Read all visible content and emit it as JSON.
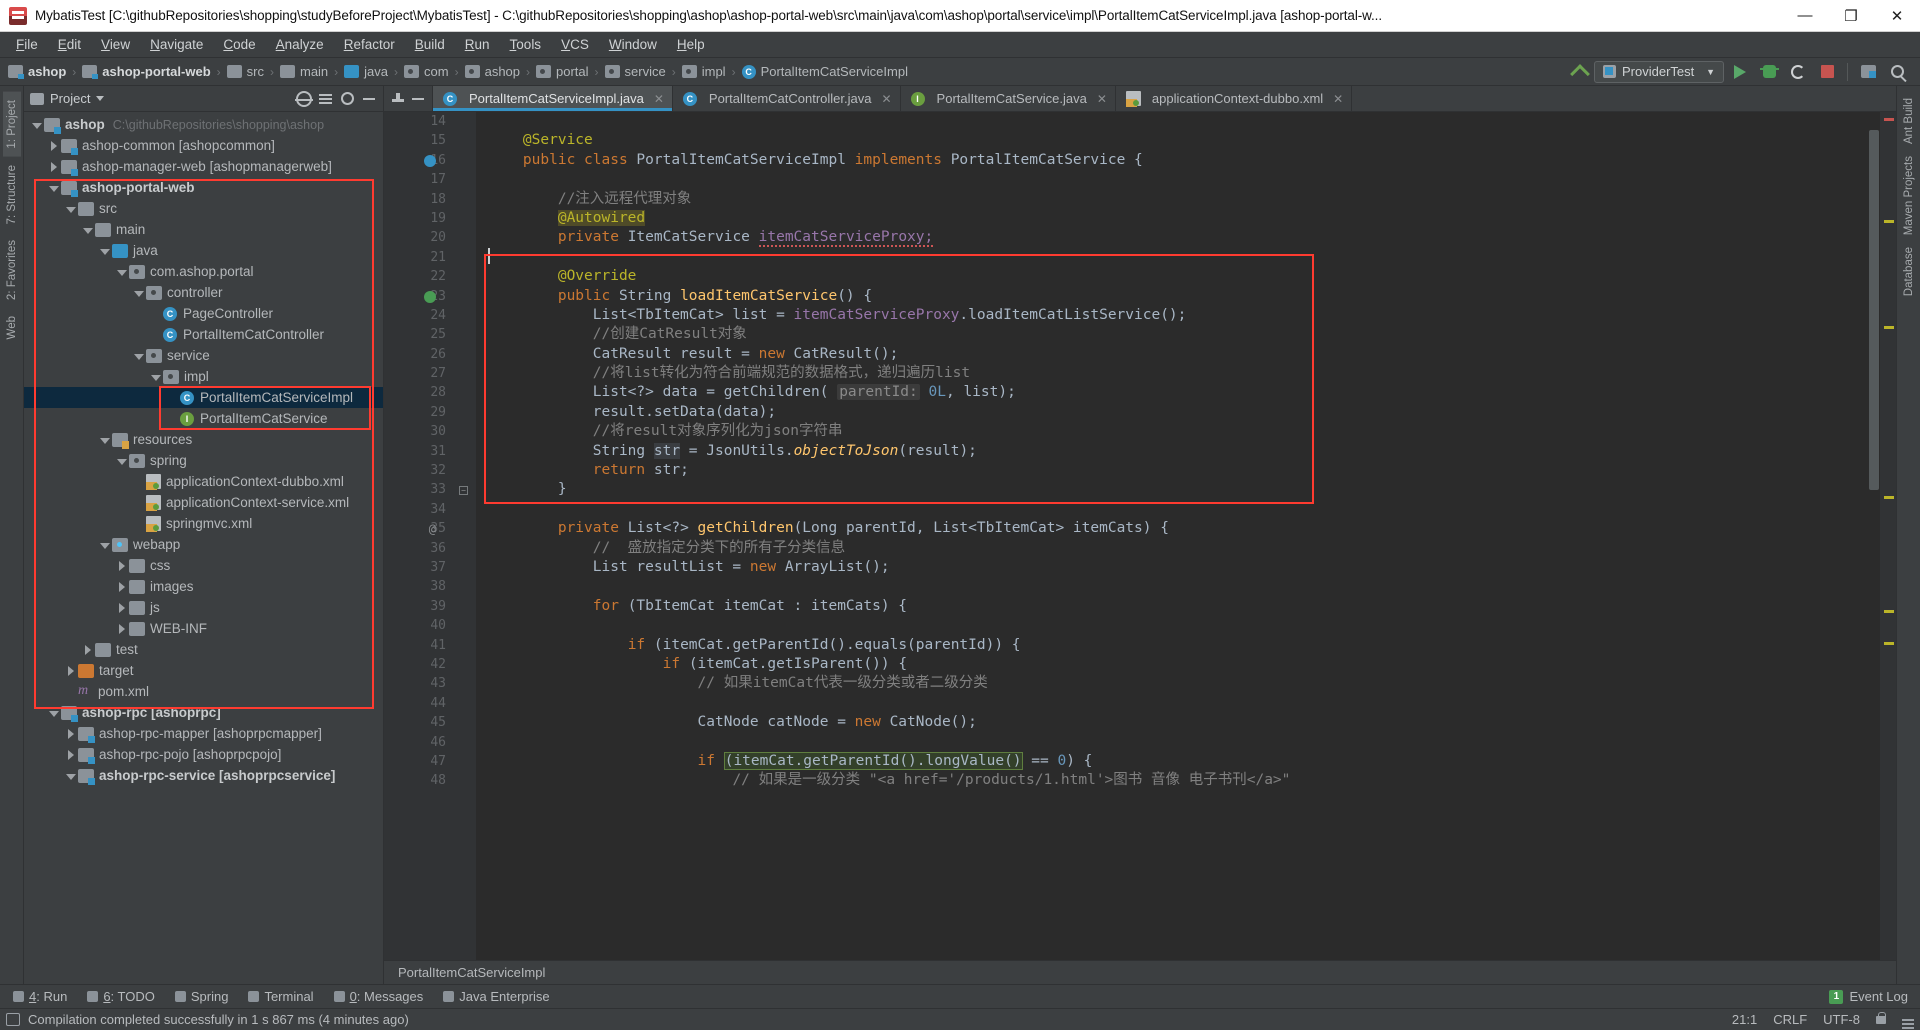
{
  "window": {
    "title": "MybatisTest [C:\\githubRepositories\\shopping\\studyBeforeProject\\MybatisTest] - C:\\githubRepositories\\shopping\\ashop\\ashop-portal-web\\src\\main\\java\\com\\ashop\\portal\\service\\impl\\PortalItemCatServiceImpl.java [ashop-portal-w...",
    "minimize": "—",
    "maximize": "❐",
    "close": "✕"
  },
  "menu": [
    {
      "label": "File"
    },
    {
      "label": "Edit"
    },
    {
      "label": "View"
    },
    {
      "label": "Navigate"
    },
    {
      "label": "Code"
    },
    {
      "label": "Analyze"
    },
    {
      "label": "Refactor"
    },
    {
      "label": "Build"
    },
    {
      "label": "Run"
    },
    {
      "label": "Tools"
    },
    {
      "label": "VCS"
    },
    {
      "label": "Window"
    },
    {
      "label": "Help"
    }
  ],
  "navbar": {
    "breadcrumbs": [
      {
        "label": "ashop",
        "icon": "module-icon",
        "bold": true
      },
      {
        "label": "ashop-portal-web",
        "icon": "module-icon",
        "bold": true
      },
      {
        "label": "src",
        "icon": "folder-icon",
        "bold": false
      },
      {
        "label": "main",
        "icon": "folder-icon",
        "bold": false
      },
      {
        "label": "java",
        "icon": "source-folder-icon",
        "bold": false
      },
      {
        "label": "com",
        "icon": "package-icon",
        "bold": false
      },
      {
        "label": "ashop",
        "icon": "package-icon",
        "bold": false
      },
      {
        "label": "portal",
        "icon": "package-icon",
        "bold": false
      },
      {
        "label": "service",
        "icon": "package-icon",
        "bold": false
      },
      {
        "label": "impl",
        "icon": "package-icon",
        "bold": false
      },
      {
        "label": "PortalItemCatServiceImpl",
        "icon": "class-icon",
        "bold": false
      }
    ],
    "separator": "›",
    "run_config": "ProviderTest",
    "class_badge": "C",
    "dropdown_caret": "▼"
  },
  "left_strip": [
    {
      "label": "1: Project",
      "selected": true
    },
    {
      "label": "7: Structure",
      "selected": false
    },
    {
      "label": "2: Favorites",
      "selected": false
    },
    {
      "label": "Web",
      "selected": false
    }
  ],
  "right_strip": [
    {
      "label": "Ant Build"
    },
    {
      "label": "Maven Projects"
    },
    {
      "label": "Database"
    }
  ],
  "project_panel": {
    "title": "Project",
    "tree": [
      {
        "indent": 0,
        "twisty": "down",
        "icon": "module-icon",
        "label": "ashop",
        "bold": true,
        "path": "C:\\githubRepositories\\shopping\\ashop"
      },
      {
        "indent": 1,
        "twisty": "right",
        "icon": "module-icon",
        "label": "ashop-common [ashopcommon]",
        "bold": false,
        "path": ""
      },
      {
        "indent": 1,
        "twisty": "right",
        "icon": "module-icon",
        "label": "ashop-manager-web [ashopmanagerweb]",
        "bold": false,
        "path": ""
      },
      {
        "indent": 1,
        "twisty": "down",
        "icon": "module-icon",
        "label": "ashop-portal-web",
        "bold": true,
        "path": ""
      },
      {
        "indent": 2,
        "twisty": "down",
        "icon": "folder-icon",
        "label": "src",
        "bold": false,
        "path": ""
      },
      {
        "indent": 3,
        "twisty": "down",
        "icon": "folder-icon",
        "label": "main",
        "bold": false,
        "path": ""
      },
      {
        "indent": 4,
        "twisty": "down",
        "icon": "source-folder-icon",
        "label": "java",
        "bold": false,
        "path": ""
      },
      {
        "indent": 5,
        "twisty": "down",
        "icon": "package-icon",
        "label": "com.ashop.portal",
        "bold": false,
        "path": ""
      },
      {
        "indent": 6,
        "twisty": "down",
        "icon": "package-icon",
        "label": "controller",
        "bold": false,
        "path": ""
      },
      {
        "indent": 7,
        "twisty": "none",
        "icon": "class-icon",
        "label": "PageController",
        "bold": false,
        "path": ""
      },
      {
        "indent": 7,
        "twisty": "none",
        "icon": "class-icon",
        "label": "PortalItemCatController",
        "bold": false,
        "path": ""
      },
      {
        "indent": 6,
        "twisty": "down",
        "icon": "package-icon",
        "label": "service",
        "bold": false,
        "path": ""
      },
      {
        "indent": 7,
        "twisty": "down",
        "icon": "package-icon",
        "label": "impl",
        "bold": false,
        "path": ""
      },
      {
        "indent": 8,
        "twisty": "none",
        "icon": "class-icon",
        "label": "PortalItemCatServiceImpl",
        "bold": false,
        "path": "",
        "selected": true
      },
      {
        "indent": 8,
        "twisty": "none",
        "icon": "interface-icon",
        "label": "PortalItemCatService",
        "bold": false,
        "path": ""
      },
      {
        "indent": 4,
        "twisty": "down",
        "icon": "resource-folder-icon",
        "label": "resources",
        "bold": false,
        "path": ""
      },
      {
        "indent": 5,
        "twisty": "down",
        "icon": "package-icon",
        "label": "spring",
        "bold": false,
        "path": ""
      },
      {
        "indent": 6,
        "twisty": "none",
        "icon": "xml-spring-icon",
        "label": "applicationContext-dubbo.xml",
        "bold": false,
        "path": ""
      },
      {
        "indent": 6,
        "twisty": "none",
        "icon": "xml-spring-icon",
        "label": "applicationContext-service.xml",
        "bold": false,
        "path": ""
      },
      {
        "indent": 6,
        "twisty": "none",
        "icon": "xml-spring-icon",
        "label": "springmvc.xml",
        "bold": false,
        "path": ""
      },
      {
        "indent": 4,
        "twisty": "down",
        "icon": "web-folder-icon",
        "label": "webapp",
        "bold": false,
        "path": ""
      },
      {
        "indent": 5,
        "twisty": "right",
        "icon": "folder-icon",
        "label": "css",
        "bold": false,
        "path": ""
      },
      {
        "indent": 5,
        "twisty": "right",
        "icon": "folder-icon",
        "label": "images",
        "bold": false,
        "path": ""
      },
      {
        "indent": 5,
        "twisty": "right",
        "icon": "folder-icon",
        "label": "js",
        "bold": false,
        "path": ""
      },
      {
        "indent": 5,
        "twisty": "right",
        "icon": "folder-icon",
        "label": "WEB-INF",
        "bold": false,
        "path": ""
      },
      {
        "indent": 3,
        "twisty": "right",
        "icon": "folder-icon",
        "label": "test",
        "bold": false,
        "path": ""
      },
      {
        "indent": 2,
        "twisty": "right",
        "icon": "target-folder-icon",
        "label": "target",
        "bold": false,
        "path": ""
      },
      {
        "indent": 2,
        "twisty": "none",
        "icon": "maven-pom-icon",
        "label": "pom.xml",
        "bold": false,
        "path": ""
      },
      {
        "indent": 1,
        "twisty": "down",
        "icon": "module-icon",
        "label": "ashop-rpc [ashoprpc]",
        "bold": true,
        "path": ""
      },
      {
        "indent": 2,
        "twisty": "right",
        "icon": "module-icon",
        "label": "ashop-rpc-mapper [ashoprpcmapper]",
        "bold": false,
        "path": ""
      },
      {
        "indent": 2,
        "twisty": "right",
        "icon": "module-icon",
        "label": "ashop-rpc-pojo [ashoprpcpojo]",
        "bold": false,
        "path": ""
      },
      {
        "indent": 2,
        "twisty": "down",
        "icon": "module-icon",
        "label": "ashop-rpc-service [ashoprpcservice]",
        "bold": true,
        "path": ""
      }
    ]
  },
  "editor": {
    "tabs": [
      {
        "label": "PortalItemCatServiceImpl.java",
        "icon": "class-icon",
        "active": true,
        "close": "✕"
      },
      {
        "label": "PortalItemCatController.java",
        "icon": "class-icon",
        "active": false,
        "close": "✕"
      },
      {
        "label": "PortalItemCatService.java",
        "icon": "interface-icon",
        "active": false,
        "close": "✕"
      },
      {
        "label": "applicationContext-dubbo.xml",
        "icon": "xml-spring-icon",
        "active": false,
        "close": "✕"
      }
    ],
    "first_line_number": 14,
    "lines": [
      {
        "n": 14,
        "segs": []
      },
      {
        "n": 15,
        "segs": [
          {
            "t": "    ",
            "c": "pl"
          },
          {
            "t": "@Service",
            "c": "ann"
          }
        ]
      },
      {
        "n": 16,
        "gutter_icon": "implemented-class-icon",
        "segs": [
          {
            "t": "    ",
            "c": "pl"
          },
          {
            "t": "public class ",
            "c": "kw"
          },
          {
            "t": "PortalItemCatServiceImpl ",
            "c": "pl"
          },
          {
            "t": "implements ",
            "c": "kw"
          },
          {
            "t": "PortalItemCatService {",
            "c": "pl"
          }
        ]
      },
      {
        "n": 17,
        "segs": []
      },
      {
        "n": 18,
        "segs": [
          {
            "t": "        ",
            "c": "pl"
          },
          {
            "t": "//注入远程代理对象",
            "c": "cm"
          }
        ]
      },
      {
        "n": 19,
        "segs": [
          {
            "t": "        ",
            "c": "pl"
          },
          {
            "t": "@Autowired",
            "c": "ann hl"
          }
        ]
      },
      {
        "n": 20,
        "segs": [
          {
            "t": "        ",
            "c": "pl"
          },
          {
            "t": "private ",
            "c": "kw"
          },
          {
            "t": "ItemCatService ",
            "c": "pl"
          },
          {
            "t": "itemCatServiceProxy;",
            "c": "fld squig"
          }
        ]
      },
      {
        "n": 21,
        "segs": [
          {
            "t": "CARET",
            "c": "caret"
          }
        ]
      },
      {
        "n": 22,
        "segs": [
          {
            "t": "        ",
            "c": "pl"
          },
          {
            "t": "@Override",
            "c": "ann"
          }
        ]
      },
      {
        "n": 23,
        "gutter_icon": "override-method-icon",
        "segs": [
          {
            "t": "        ",
            "c": "pl"
          },
          {
            "t": "public ",
            "c": "kw"
          },
          {
            "t": "String ",
            "c": "pl"
          },
          {
            "t": "loadItemCatService",
            "c": "mth"
          },
          {
            "t": "() {",
            "c": "pl"
          }
        ]
      },
      {
        "n": 24,
        "segs": [
          {
            "t": "            List<TbItemCat> list = ",
            "c": "pl"
          },
          {
            "t": "itemCatServiceProxy",
            "c": "fld"
          },
          {
            "t": ".loadItemCatListService();",
            "c": "pl"
          }
        ]
      },
      {
        "n": 25,
        "segs": [
          {
            "t": "            ",
            "c": "pl"
          },
          {
            "t": "//创建CatResult对象",
            "c": "cm"
          }
        ]
      },
      {
        "n": 26,
        "segs": [
          {
            "t": "            CatResult result = ",
            "c": "pl"
          },
          {
            "t": "new ",
            "c": "kw"
          },
          {
            "t": "CatResult();",
            "c": "pl"
          }
        ]
      },
      {
        "n": 27,
        "segs": [
          {
            "t": "            ",
            "c": "pl"
          },
          {
            "t": "//将list转化为符合前端规范的数据格式，递归遍历list",
            "c": "cm"
          }
        ]
      },
      {
        "n": 28,
        "segs": [
          {
            "t": "            List<?> data = ",
            "c": "pl"
          },
          {
            "t": "getChildren",
            "c": "pl"
          },
          {
            "t": "( ",
            "c": "pl"
          },
          {
            "t": "parentId:",
            "c": "hint"
          },
          {
            "t": " ",
            "c": "pl"
          },
          {
            "t": "0L",
            "c": "num"
          },
          {
            "t": ", list);",
            "c": "pl"
          }
        ]
      },
      {
        "n": 29,
        "segs": [
          {
            "t": "            result.setData(data);",
            "c": "pl"
          }
        ]
      },
      {
        "n": 30,
        "segs": [
          {
            "t": "            ",
            "c": "pl"
          },
          {
            "t": "//将result对象序列化为json字符串",
            "c": "cm"
          }
        ]
      },
      {
        "n": 31,
        "segs": [
          {
            "t": "            String ",
            "c": "pl"
          },
          {
            "t": "str",
            "c": "pl hl2"
          },
          {
            "t": " = JsonUtils.",
            "c": "pl"
          },
          {
            "t": "objectToJson",
            "c": "mth-italic"
          },
          {
            "t": "(result);",
            "c": "pl"
          }
        ]
      },
      {
        "n": 32,
        "segs": [
          {
            "t": "            ",
            "c": "pl"
          },
          {
            "t": "return ",
            "c": "kw"
          },
          {
            "t": "str;",
            "c": "pl"
          }
        ]
      },
      {
        "n": 33,
        "fold": true,
        "segs": [
          {
            "t": "        }",
            "c": "pl"
          }
        ]
      },
      {
        "n": 34,
        "segs": []
      },
      {
        "n": 35,
        "gutter_icon": "at-icon",
        "segs": [
          {
            "t": "        ",
            "c": "pl"
          },
          {
            "t": "private ",
            "c": "kw"
          },
          {
            "t": "List<?> ",
            "c": "pl"
          },
          {
            "t": "getChildren",
            "c": "mth"
          },
          {
            "t": "(Long parentId, List<TbItemCat> itemCats) {",
            "c": "pl"
          }
        ]
      },
      {
        "n": 36,
        "segs": [
          {
            "t": "            ",
            "c": "pl"
          },
          {
            "t": "//  盛放指定分类下的所有子分类信息",
            "c": "cm"
          }
        ]
      },
      {
        "n": 37,
        "segs": [
          {
            "t": "            List resultList = ",
            "c": "pl"
          },
          {
            "t": "new ",
            "c": "kw"
          },
          {
            "t": "ArrayList();",
            "c": "pl"
          }
        ]
      },
      {
        "n": 38,
        "segs": []
      },
      {
        "n": 39,
        "segs": [
          {
            "t": "            ",
            "c": "pl"
          },
          {
            "t": "for ",
            "c": "kw"
          },
          {
            "t": "(TbItemCat itemCat : itemCats) {",
            "c": "pl"
          }
        ]
      },
      {
        "n": 40,
        "segs": []
      },
      {
        "n": 41,
        "segs": [
          {
            "t": "                ",
            "c": "pl"
          },
          {
            "t": "if ",
            "c": "kw"
          },
          {
            "t": "(itemCat.getParentId().equals(parentId)) {",
            "c": "pl"
          }
        ]
      },
      {
        "n": 42,
        "segs": [
          {
            "t": "                    ",
            "c": "pl"
          },
          {
            "t": "if ",
            "c": "kw"
          },
          {
            "t": "(itemCat.getIsParent()) {",
            "c": "pl"
          }
        ]
      },
      {
        "n": 43,
        "segs": [
          {
            "t": "                        ",
            "c": "pl"
          },
          {
            "t": "// 如果itemCat代表一级分类或者二级分类",
            "c": "cm"
          }
        ]
      },
      {
        "n": 44,
        "segs": []
      },
      {
        "n": 45,
        "segs": [
          {
            "t": "                        CatNode catNode = ",
            "c": "pl"
          },
          {
            "t": "new ",
            "c": "kw"
          },
          {
            "t": "CatNode();",
            "c": "pl"
          }
        ]
      },
      {
        "n": 46,
        "segs": []
      },
      {
        "n": 47,
        "segs": [
          {
            "t": "                        ",
            "c": "pl"
          },
          {
            "t": "if ",
            "c": "kw"
          },
          {
            "t": "(itemCat.getParentId().longValue()",
            "c": "pl boxsel"
          },
          {
            "t": " == ",
            "c": "pl"
          },
          {
            "t": "0",
            "c": "num"
          },
          {
            "t": ") {",
            "c": "pl"
          }
        ]
      },
      {
        "n": 48,
        "segs": [
          {
            "t": "                            ",
            "c": "pl"
          },
          {
            "t": "// 如果是一级分类 \"<a href='/products/1.html'>图书 音像 电子书刊</a>\"",
            "c": "cm"
          }
        ]
      }
    ],
    "breadcrumb_bottom": "PortalItemCatServiceImpl"
  },
  "tool_windows": [
    {
      "key": "4",
      "label": ": Run",
      "icon": "run-icon"
    },
    {
      "key": "6",
      "label": ": TODO",
      "icon": "todo-icon"
    },
    {
      "key": "",
      "label": "Spring",
      "icon": "spring-icon"
    },
    {
      "key": "",
      "label": "Terminal",
      "icon": "terminal-icon"
    },
    {
      "key": "0",
      "label": ": Messages",
      "icon": "messages-icon"
    },
    {
      "key": "",
      "label": "Java Enterprise",
      "icon": "java-ee-icon"
    }
  ],
  "event_log": {
    "count": "1",
    "label": "Event Log"
  },
  "status_bar": {
    "message": "Compilation completed successfully in 1 s 867 ms (4 minutes ago)",
    "caret_position": "21:1",
    "line_separator": "CRLF",
    "encoding": "UTF-8",
    "lock": "🔒",
    "menu": "☰"
  },
  "colors": {
    "accent": "#3592c4",
    "highlight_box": "#ff3b30",
    "selection": "#0d293e",
    "annotation": "#bbb529",
    "keyword": "#cc7832",
    "comment": "#808080",
    "field": "#9876aa",
    "method": "#ffc66d",
    "number": "#6897bb"
  }
}
